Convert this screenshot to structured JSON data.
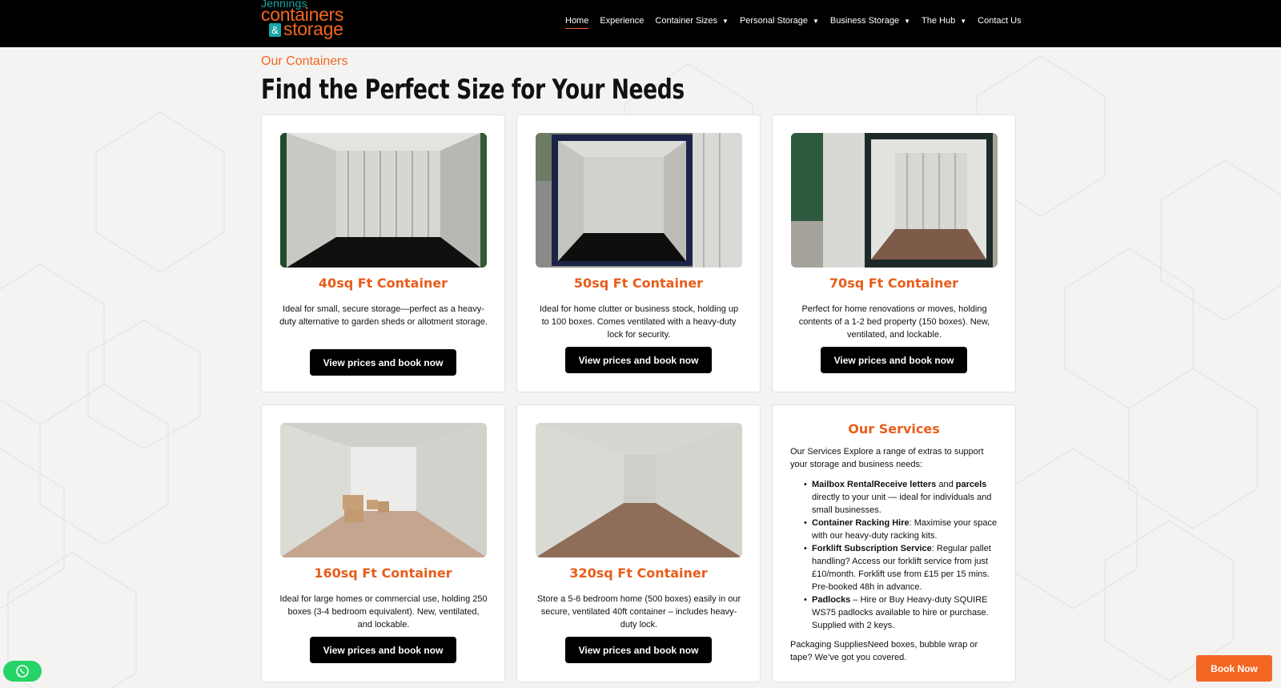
{
  "header": {
    "logo": {
      "line1": "Jennings",
      "line2": "containers",
      "amp": "&",
      "line3": "storage"
    },
    "nav": [
      {
        "label": "Home",
        "caret": ""
      },
      {
        "label": "Experience",
        "caret": ""
      },
      {
        "label": "Container Sizes",
        "caret": "▼"
      },
      {
        "label": "Personal Storage",
        "caret": "▼"
      },
      {
        "label": "Business Storage",
        "caret": "▼"
      },
      {
        "label": "The Hub",
        "caret": "▼"
      },
      {
        "label": "Contact Us",
        "caret": ""
      }
    ]
  },
  "section": {
    "eyebrow": "Our Containers",
    "title": "Find the Perfect Size for Your Needs"
  },
  "containers": [
    {
      "title": "40sq Ft Container",
      "desc": "Ideal for small, secure storage—perfect as a heavy-duty alternative to garden sheds or allotment storage.",
      "button": "View prices and book now"
    },
    {
      "title": "50sq Ft Container",
      "desc": "Ideal for home clutter or business stock, holding up to 100 boxes. Comes ventilated with a heavy-duty lock for security.",
      "button": "View prices and book now"
    },
    {
      "title": "70sq Ft Container",
      "desc": "Perfect for home renovations or moves, holding contents of a 1-2 bed property (150 boxes). New, ventilated, and lockable.",
      "button": "View prices and book now"
    },
    {
      "title": "160sq Ft Container",
      "desc": "Ideal for large homes or commercial use, holding 250 boxes (3-4 bedroom equivalent). New, ventilated, and lockable.",
      "button": "View prices and book now"
    },
    {
      "title": "320sq Ft Container",
      "desc": "Store a 5-6 bedroom home (500 boxes) easily in our secure, ventilated 40ft container – includes heavy-duty lock.",
      "button": "View prices and book now"
    }
  ],
  "services": {
    "title": "Our Services",
    "intro": "Our Services Explore a range of extras to support your storage and business needs:",
    "items": [
      {
        "b1": "Mailbox RentalReceive letters",
        "t1": " and ",
        "b2": "parcels",
        "t2": " directly to your unit — ideal for individuals and small businesses."
      },
      {
        "b1": "Container Racking Hire",
        "t1": ": Maximise your space with our heavy-duty racking kits.",
        "b2": "",
        "t2": ""
      },
      {
        "b1": "Forklift Subscription Service",
        "t1": ": Regular pallet handling? Access our forklift service from just £10/month. Forklift use from £15 per 15 mins. Pre-booked 48h in advance.",
        "b2": "",
        "t2": ""
      },
      {
        "b1": "Padlocks",
        "t1": " – Hire or Buy Heavy-duty SQUIRE WS75 padlocks available to hire or purchase. Supplied with 2 keys.",
        "b2": "",
        "t2": ""
      }
    ],
    "outro": "Packaging SuppliesNeed boxes, bubble wrap or tape? We’ve got you covered."
  },
  "floating": {
    "whatsapp_icon": "whatsapp-icon",
    "book_now": "Book Now"
  }
}
